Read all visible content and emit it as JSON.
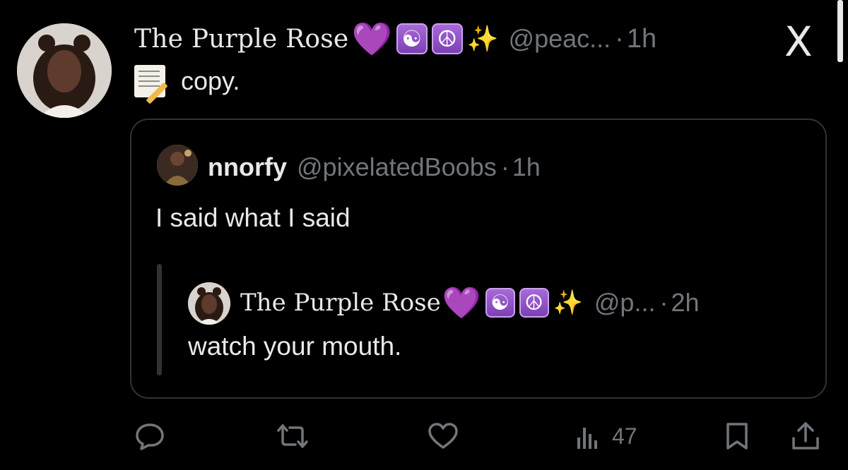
{
  "main_post": {
    "author_name": "The Purple Rose",
    "emoji_heart": "💜",
    "emoji_yinyang": "☯",
    "emoji_peace": "☮",
    "emoji_sparkles": "✨",
    "handle": "@peac...",
    "separator": "·",
    "time": "1h",
    "text": "copy."
  },
  "close_label": "X",
  "quoted_post": {
    "author_name": "nnorfy",
    "handle": "@pixelatedBoobs",
    "separator": "·",
    "time": "1h",
    "text": "I said what I said"
  },
  "nested_post": {
    "author_name": "The Purple Rose",
    "emoji_heart": "💜",
    "emoji_yinyang": "☯",
    "emoji_peace": "☮",
    "emoji_sparkles": "✨",
    "handle": "@p...",
    "separator": "·",
    "time": "2h",
    "text": "watch your mouth."
  },
  "actions": {
    "views_count": "47"
  },
  "colors": {
    "background": "#000000",
    "text": "#e7e9ea",
    "muted": "#71767b",
    "border": "#2f3336",
    "purple": "#9b59e6"
  }
}
